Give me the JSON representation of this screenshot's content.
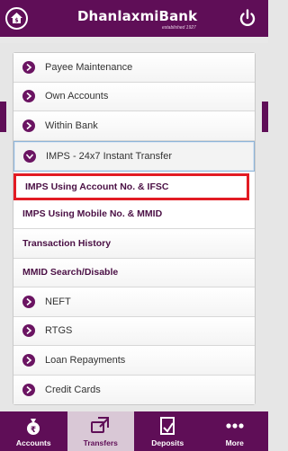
{
  "header": {
    "brand": "DhanlaxmiBank",
    "tagline": "established 1927"
  },
  "menu": {
    "items": [
      {
        "label": "Payee Maintenance",
        "state": "collapsed"
      },
      {
        "label": "Own Accounts",
        "state": "collapsed"
      },
      {
        "label": "Within Bank",
        "state": "collapsed"
      },
      {
        "label": "IMPS - 24x7 Instant Transfer",
        "state": "expanded"
      }
    ],
    "sub_items": [
      {
        "label": "IMPS Using Account No. & IFSC",
        "highlighted": true
      },
      {
        "label": "IMPS Using Mobile No. & MMID"
      }
    ],
    "sections": [
      {
        "label": "Transaction History"
      },
      {
        "label": "MMID Search/Disable"
      }
    ],
    "more_items": [
      {
        "label": "NEFT"
      },
      {
        "label": "RTGS"
      },
      {
        "label": "Loan Repayments"
      },
      {
        "label": "Credit Cards"
      }
    ]
  },
  "bottom_nav": {
    "tabs": [
      {
        "label": "Accounts",
        "icon": "money-bag-icon",
        "active": false
      },
      {
        "label": "Transfers",
        "icon": "transfer-icon",
        "active": true
      },
      {
        "label": "Deposits",
        "icon": "deposit-icon",
        "active": false
      },
      {
        "label": "More",
        "icon": "more-dots-icon",
        "active": false
      }
    ]
  },
  "colors": {
    "brand_purple": "#5f0e57",
    "highlight_red": "#e21c24",
    "expanded_border": "#8fb4d8"
  }
}
